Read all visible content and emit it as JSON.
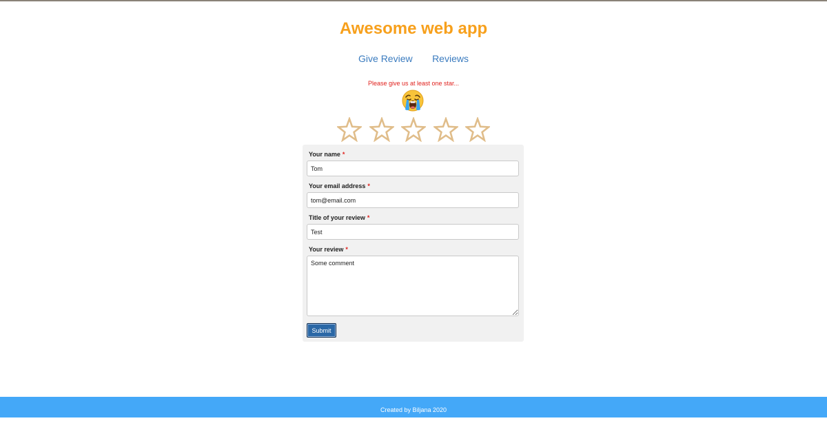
{
  "header": {
    "title": "Awesome web app"
  },
  "nav": {
    "items": [
      {
        "label": "Give Review"
      },
      {
        "label": "Reviews"
      }
    ]
  },
  "rating": {
    "warning": "Please give us at least one star...",
    "face_icon": "crying-face-emoji",
    "star_icon": "star-outline-icon",
    "star_color": "#e0bd8a",
    "max_stars": 5,
    "selected_stars": 0
  },
  "form": {
    "name": {
      "label": "Your name",
      "required_mark": "*",
      "value": "Tom"
    },
    "email": {
      "label": "Your email address",
      "required_mark": "*",
      "value": "tom@email.com"
    },
    "title": {
      "label": "Title of your review",
      "required_mark": "*",
      "value": "Test"
    },
    "review": {
      "label": "Your review",
      "required_mark": "*",
      "value": "Some comment"
    },
    "submit_label": "Submit"
  },
  "footer": {
    "text": "Created by Biljana 2020"
  },
  "colors": {
    "title": "#f7a01c",
    "link": "#3a7bbf",
    "warning": "#e0201c",
    "footer_bg": "#44a8f8",
    "panel_bg": "#f1f1f1",
    "submit_bg": "#2b68a6"
  }
}
